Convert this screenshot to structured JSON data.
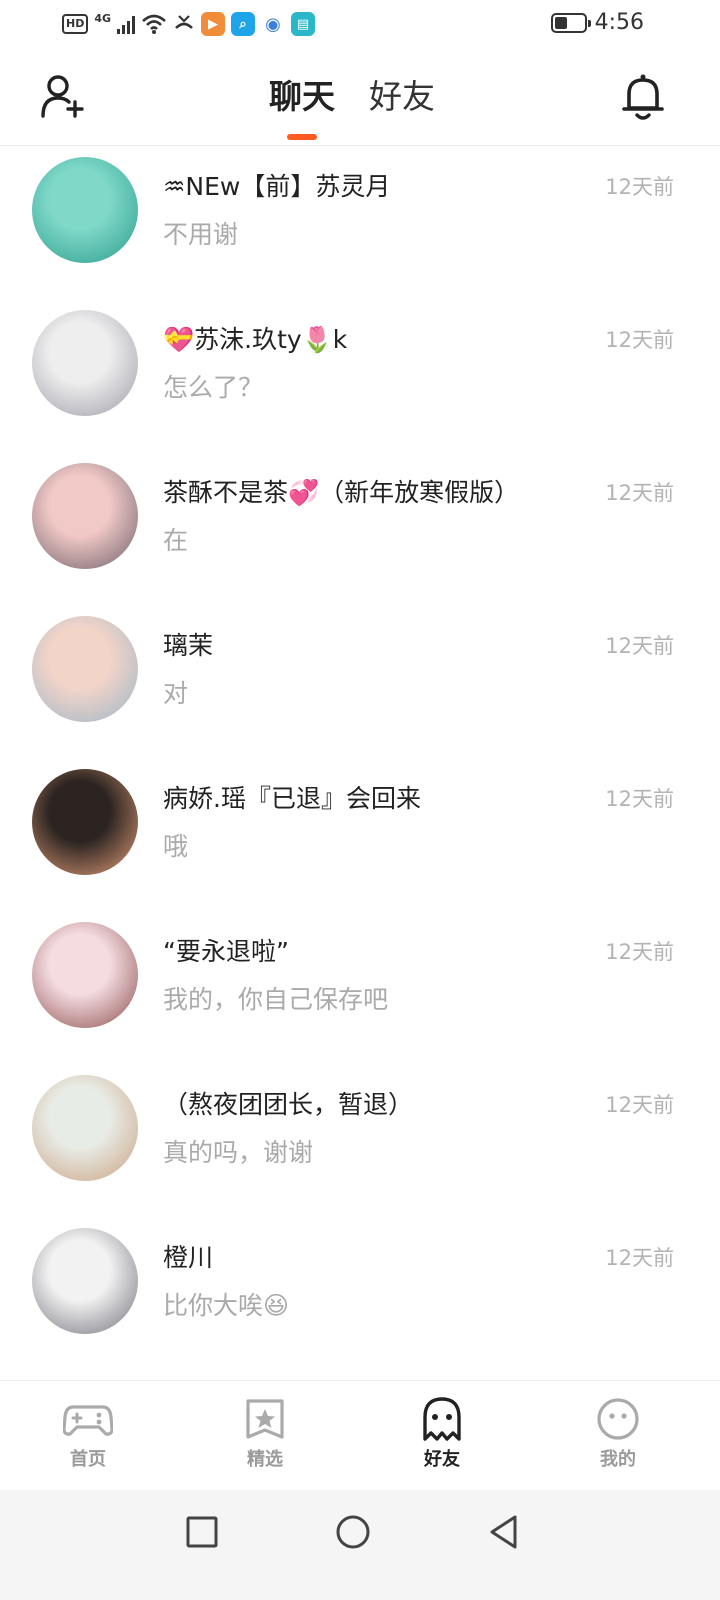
{
  "status_bar": {
    "hd": "HD",
    "network": "4G",
    "time": "4:56",
    "app_icons": [
      "bilibili-like-app-icon",
      "search-app-icon",
      "browser-app-icon",
      "reader-app-icon"
    ]
  },
  "header": {
    "tabs": [
      {
        "label": "聊天",
        "active": true
      },
      {
        "label": "好友",
        "active": false
      }
    ],
    "accent": "#ff5a1f"
  },
  "chats": [
    {
      "name": "♒NEw【前】苏灵月",
      "time": "12天前",
      "preview": "不用谢",
      "avatar_colors": [
        "#7fd8c8",
        "#2a9c8c"
      ]
    },
    {
      "name": "💝苏沫.玖ty🌷k",
      "time": "12天前",
      "preview": "怎么了？",
      "avatar_colors": [
        "#eeeeee",
        "#9a9aa6"
      ]
    },
    {
      "name": "茶酥不是茶💞（新年放寒假版）",
      "time": "12天前",
      "preview": "在",
      "avatar_colors": [
        "#f1c9c7",
        "#6b5d66"
      ]
    },
    {
      "name": "璃茉",
      "time": "12天前",
      "preview": "对",
      "avatar_colors": [
        "#f3d4c8",
        "#9bb6c9"
      ]
    },
    {
      "name": "病娇.瑶『已退』会回来",
      "time": "12天前",
      "preview": "哦",
      "avatar_colors": [
        "#2b2421",
        "#e7a07a"
      ]
    },
    {
      "name": "“要永退啦”",
      "time": "12天前",
      "preview": "我的，你自己保存吧",
      "avatar_colors": [
        "#f4dce0",
        "#8a4b4a"
      ]
    },
    {
      "name": "（熬夜团团长，暂退）",
      "time": "12天前",
      "preview": "真的吗，谢谢",
      "avatar_colors": [
        "#e8ece6",
        "#c9a07f"
      ]
    },
    {
      "name": "橙川",
      "time": "12天前",
      "preview": "比你大唉😆",
      "avatar_colors": [
        "#f2f2f2",
        "#6e6e78"
      ]
    }
  ],
  "bottom_nav": [
    {
      "label": "首页",
      "icon": "gamepad-icon",
      "active": false
    },
    {
      "label": "精选",
      "icon": "star-bookmark-icon",
      "active": false
    },
    {
      "label": "好友",
      "icon": "ghost-icon",
      "active": true
    },
    {
      "label": "我的",
      "icon": "smiley-face-icon",
      "active": false
    }
  ],
  "system_nav": [
    "recent-apps-icon",
    "home-icon",
    "back-icon"
  ]
}
